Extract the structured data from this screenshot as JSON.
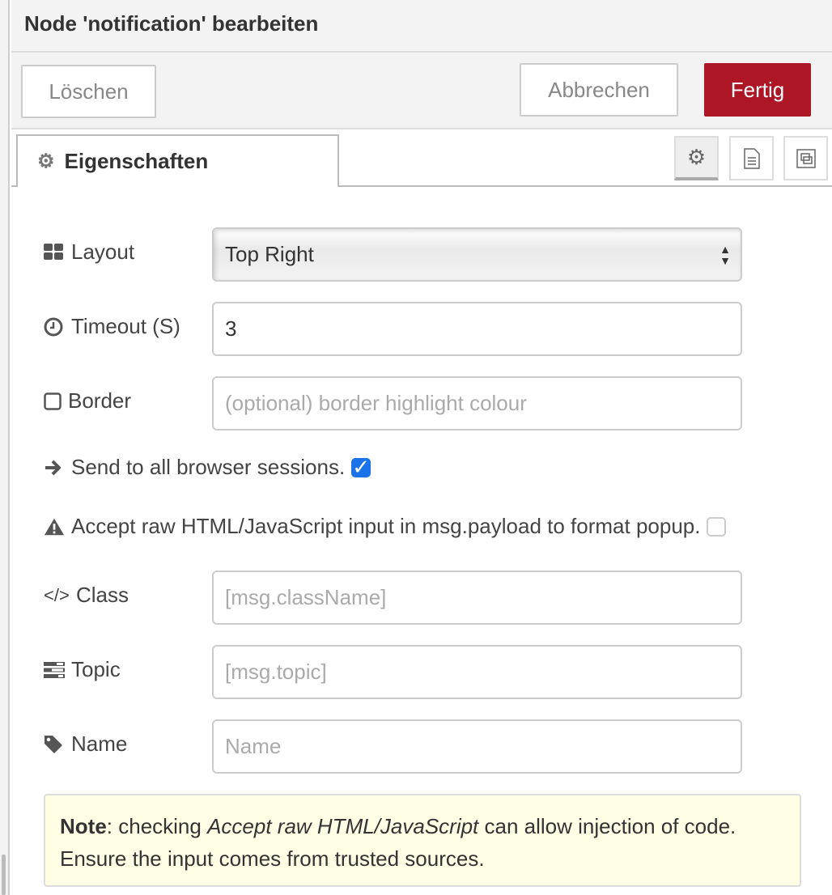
{
  "header": {
    "title": "Node 'notification' bearbeiten"
  },
  "buttons": {
    "delete": "Löschen",
    "cancel": "Abbrechen",
    "done": "Fertig"
  },
  "tab": {
    "label": "Eigenschaften",
    "icon": "gear-icon"
  },
  "side_tabs": [
    {
      "icon": "gear-icon",
      "active": true
    },
    {
      "icon": "document-icon"
    },
    {
      "icon": "frame-icon"
    }
  ],
  "form": {
    "layout": {
      "label": "Layout",
      "icon": "th-large-icon",
      "value": "Top Right"
    },
    "timeout": {
      "label": "Timeout (S)",
      "icon": "clock-icon",
      "value": "3"
    },
    "border": {
      "label": "Border",
      "icon": "square-icon",
      "placeholder": "(optional) border highlight colour"
    },
    "send_all": {
      "label": "Send to all browser sessions.",
      "icon": "arrow-right-icon",
      "checked": true
    },
    "accept_raw": {
      "label": "Accept raw HTML/JavaScript input in msg.payload to format popup.",
      "icon": "warning-icon",
      "checked": false
    },
    "class": {
      "label": "Class",
      "icon": "code-icon",
      "placeholder": "[msg.className]"
    },
    "topic": {
      "label": "Topic",
      "icon": "tasks-icon",
      "placeholder": "[msg.topic]"
    },
    "name": {
      "label": "Name",
      "icon": "tag-icon",
      "placeholder": "Name"
    }
  },
  "note": {
    "bold": "Note",
    "text1": ": checking ",
    "italic": "Accept raw HTML/JavaScript",
    "text2": " can allow injection of code. Ensure the input comes from trusted sources."
  },
  "colors": {
    "primary": "#ad1625",
    "checkbox": "#1a73e8",
    "note_bg": "#ffffe6"
  }
}
